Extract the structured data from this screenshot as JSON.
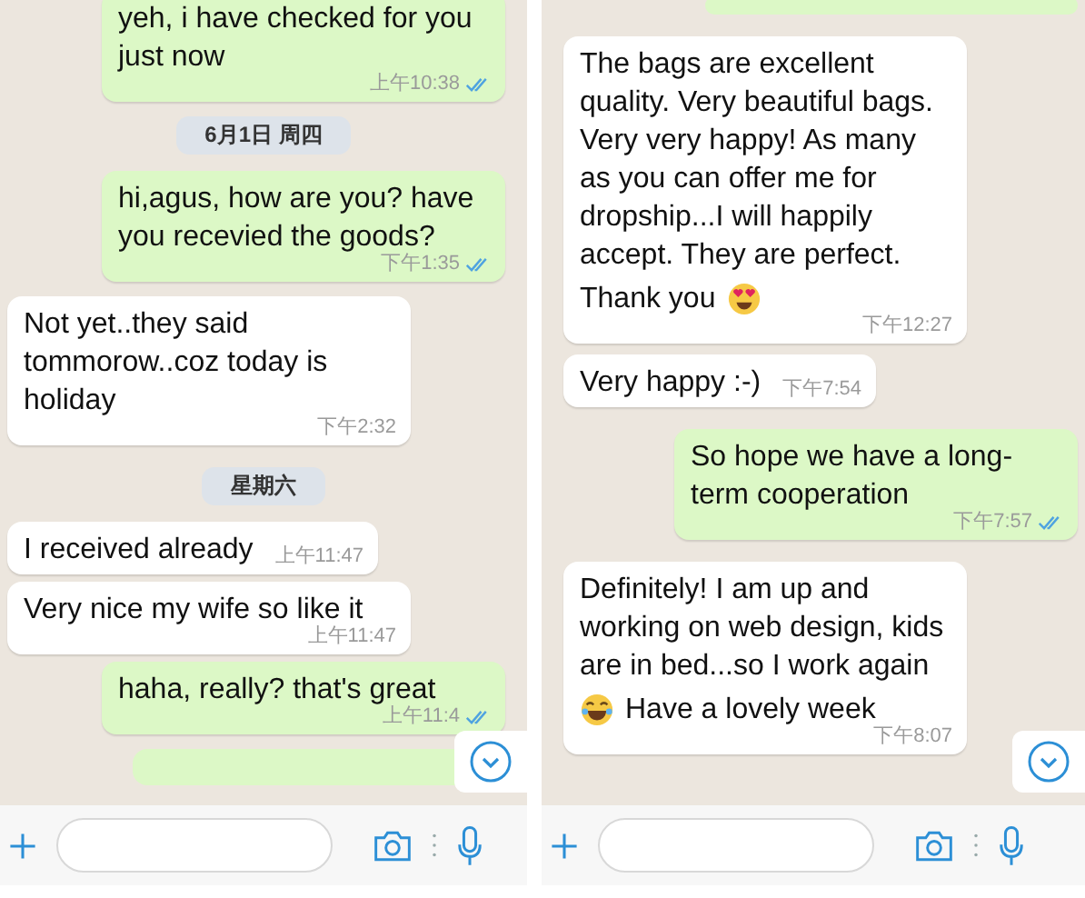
{
  "panels": [
    {
      "messages": [
        {
          "kind": "outgoing",
          "text": "yeh, i have checked for you just now",
          "time": "上午10:38",
          "read": true
        },
        {
          "kind": "date",
          "text": "6月1日 周四"
        },
        {
          "kind": "outgoing",
          "text": "hi,agus, how are you? have you recevied the goods?",
          "time": "下午1:35",
          "read": true
        },
        {
          "kind": "incoming",
          "text": "Not yet..they said tommorow..coz today is holiday",
          "time": "下午2:32"
        },
        {
          "kind": "date",
          "text": "星期六"
        },
        {
          "kind": "incoming",
          "text": "I received already",
          "time": "上午11:47"
        },
        {
          "kind": "incoming",
          "text": "Very nice my wife so like it",
          "time": "上午11:47"
        },
        {
          "kind": "outgoing",
          "text": "haha, really? that's great",
          "time": "上午11:4",
          "read": true
        },
        {
          "kind": "fragment"
        }
      ]
    },
    {
      "messages": [
        {
          "kind": "fragment"
        },
        {
          "kind": "incoming",
          "text": "The bags are excellent quality. Very beautiful bags. Very very happy! As many as you can offer me for dropship...I will happily accept. They are perfect.",
          "last_line": "Thank you",
          "emoji_first": false,
          "time": "下午12:27"
        },
        {
          "kind": "incoming",
          "text": "Very happy :-)",
          "time": "下午7:54"
        },
        {
          "kind": "outgoing",
          "text": "So hope we have a long-term cooperation",
          "time": "下午7:57",
          "read": true
        },
        {
          "kind": "incoming",
          "text": "Definitely! I am up and working on web design, kids are in bed...so I work again",
          "last_line": "Have a lovely week",
          "emoji_first": true,
          "time": "下午8:07"
        }
      ]
    }
  ]
}
